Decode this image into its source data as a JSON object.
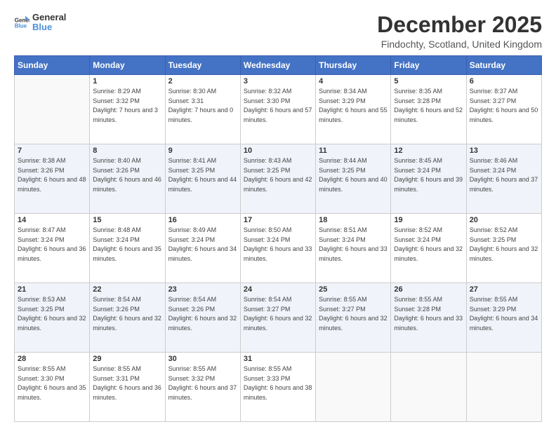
{
  "logo": {
    "general": "General",
    "blue": "Blue"
  },
  "title": "December 2025",
  "location": "Findochty, Scotland, United Kingdom",
  "weekdays": [
    "Sunday",
    "Monday",
    "Tuesday",
    "Wednesday",
    "Thursday",
    "Friday",
    "Saturday"
  ],
  "weeks": [
    [
      {
        "day": "",
        "sunrise": "",
        "sunset": "",
        "daylight": ""
      },
      {
        "day": "1",
        "sunrise": "Sunrise: 8:29 AM",
        "sunset": "Sunset: 3:32 PM",
        "daylight": "Daylight: 7 hours and 3 minutes."
      },
      {
        "day": "2",
        "sunrise": "Sunrise: 8:30 AM",
        "sunset": "Sunset: 3:31",
        "daylight": "Daylight: 7 hours and 0 minutes."
      },
      {
        "day": "3",
        "sunrise": "Sunrise: 8:32 AM",
        "sunset": "Sunset: 3:30 PM",
        "daylight": "Daylight: 6 hours and 57 minutes."
      },
      {
        "day": "4",
        "sunrise": "Sunrise: 8:34 AM",
        "sunset": "Sunset: 3:29 PM",
        "daylight": "Daylight: 6 hours and 55 minutes."
      },
      {
        "day": "5",
        "sunrise": "Sunrise: 8:35 AM",
        "sunset": "Sunset: 3:28 PM",
        "daylight": "Daylight: 6 hours and 52 minutes."
      },
      {
        "day": "6",
        "sunrise": "Sunrise: 8:37 AM",
        "sunset": "Sunset: 3:27 PM",
        "daylight": "Daylight: 6 hours and 50 minutes."
      }
    ],
    [
      {
        "day": "7",
        "sunrise": "Sunrise: 8:38 AM",
        "sunset": "Sunset: 3:26 PM",
        "daylight": "Daylight: 6 hours and 48 minutes."
      },
      {
        "day": "8",
        "sunrise": "Sunrise: 8:40 AM",
        "sunset": "Sunset: 3:26 PM",
        "daylight": "Daylight: 6 hours and 46 minutes."
      },
      {
        "day": "9",
        "sunrise": "Sunrise: 8:41 AM",
        "sunset": "Sunset: 3:25 PM",
        "daylight": "Daylight: 6 hours and 44 minutes."
      },
      {
        "day": "10",
        "sunrise": "Sunrise: 8:43 AM",
        "sunset": "Sunset: 3:25 PM",
        "daylight": "Daylight: 6 hours and 42 minutes."
      },
      {
        "day": "11",
        "sunrise": "Sunrise: 8:44 AM",
        "sunset": "Sunset: 3:25 PM",
        "daylight": "Daylight: 6 hours and 40 minutes."
      },
      {
        "day": "12",
        "sunrise": "Sunrise: 8:45 AM",
        "sunset": "Sunset: 3:24 PM",
        "daylight": "Daylight: 6 hours and 39 minutes."
      },
      {
        "day": "13",
        "sunrise": "Sunrise: 8:46 AM",
        "sunset": "Sunset: 3:24 PM",
        "daylight": "Daylight: 6 hours and 37 minutes."
      }
    ],
    [
      {
        "day": "14",
        "sunrise": "Sunrise: 8:47 AM",
        "sunset": "Sunset: 3:24 PM",
        "daylight": "Daylight: 6 hours and 36 minutes."
      },
      {
        "day": "15",
        "sunrise": "Sunrise: 8:48 AM",
        "sunset": "Sunset: 3:24 PM",
        "daylight": "Daylight: 6 hours and 35 minutes."
      },
      {
        "day": "16",
        "sunrise": "Sunrise: 8:49 AM",
        "sunset": "Sunset: 3:24 PM",
        "daylight": "Daylight: 6 hours and 34 minutes."
      },
      {
        "day": "17",
        "sunrise": "Sunrise: 8:50 AM",
        "sunset": "Sunset: 3:24 PM",
        "daylight": "Daylight: 6 hours and 33 minutes."
      },
      {
        "day": "18",
        "sunrise": "Sunrise: 8:51 AM",
        "sunset": "Sunset: 3:24 PM",
        "daylight": "Daylight: 6 hours and 33 minutes."
      },
      {
        "day": "19",
        "sunrise": "Sunrise: 8:52 AM",
        "sunset": "Sunset: 3:24 PM",
        "daylight": "Daylight: 6 hours and 32 minutes."
      },
      {
        "day": "20",
        "sunrise": "Sunrise: 8:52 AM",
        "sunset": "Sunset: 3:25 PM",
        "daylight": "Daylight: 6 hours and 32 minutes."
      }
    ],
    [
      {
        "day": "21",
        "sunrise": "Sunrise: 8:53 AM",
        "sunset": "Sunset: 3:25 PM",
        "daylight": "Daylight: 6 hours and 32 minutes."
      },
      {
        "day": "22",
        "sunrise": "Sunrise: 8:54 AM",
        "sunset": "Sunset: 3:26 PM",
        "daylight": "Daylight: 6 hours and 32 minutes."
      },
      {
        "day": "23",
        "sunrise": "Sunrise: 8:54 AM",
        "sunset": "Sunset: 3:26 PM",
        "daylight": "Daylight: 6 hours and 32 minutes."
      },
      {
        "day": "24",
        "sunrise": "Sunrise: 8:54 AM",
        "sunset": "Sunset: 3:27 PM",
        "daylight": "Daylight: 6 hours and 32 minutes."
      },
      {
        "day": "25",
        "sunrise": "Sunrise: 8:55 AM",
        "sunset": "Sunset: 3:27 PM",
        "daylight": "Daylight: 6 hours and 32 minutes."
      },
      {
        "day": "26",
        "sunrise": "Sunrise: 8:55 AM",
        "sunset": "Sunset: 3:28 PM",
        "daylight": "Daylight: 6 hours and 33 minutes."
      },
      {
        "day": "27",
        "sunrise": "Sunrise: 8:55 AM",
        "sunset": "Sunset: 3:29 PM",
        "daylight": "Daylight: 6 hours and 34 minutes."
      }
    ],
    [
      {
        "day": "28",
        "sunrise": "Sunrise: 8:55 AM",
        "sunset": "Sunset: 3:30 PM",
        "daylight": "Daylight: 6 hours and 35 minutes."
      },
      {
        "day": "29",
        "sunrise": "Sunrise: 8:55 AM",
        "sunset": "Sunset: 3:31 PM",
        "daylight": "Daylight: 6 hours and 36 minutes."
      },
      {
        "day": "30",
        "sunrise": "Sunrise: 8:55 AM",
        "sunset": "Sunset: 3:32 PM",
        "daylight": "Daylight: 6 hours and 37 minutes."
      },
      {
        "day": "31",
        "sunrise": "Sunrise: 8:55 AM",
        "sunset": "Sunset: 3:33 PM",
        "daylight": "Daylight: 6 hours and 38 minutes."
      },
      {
        "day": "",
        "sunrise": "",
        "sunset": "",
        "daylight": ""
      },
      {
        "day": "",
        "sunrise": "",
        "sunset": "",
        "daylight": ""
      },
      {
        "day": "",
        "sunrise": "",
        "sunset": "",
        "daylight": ""
      }
    ]
  ]
}
